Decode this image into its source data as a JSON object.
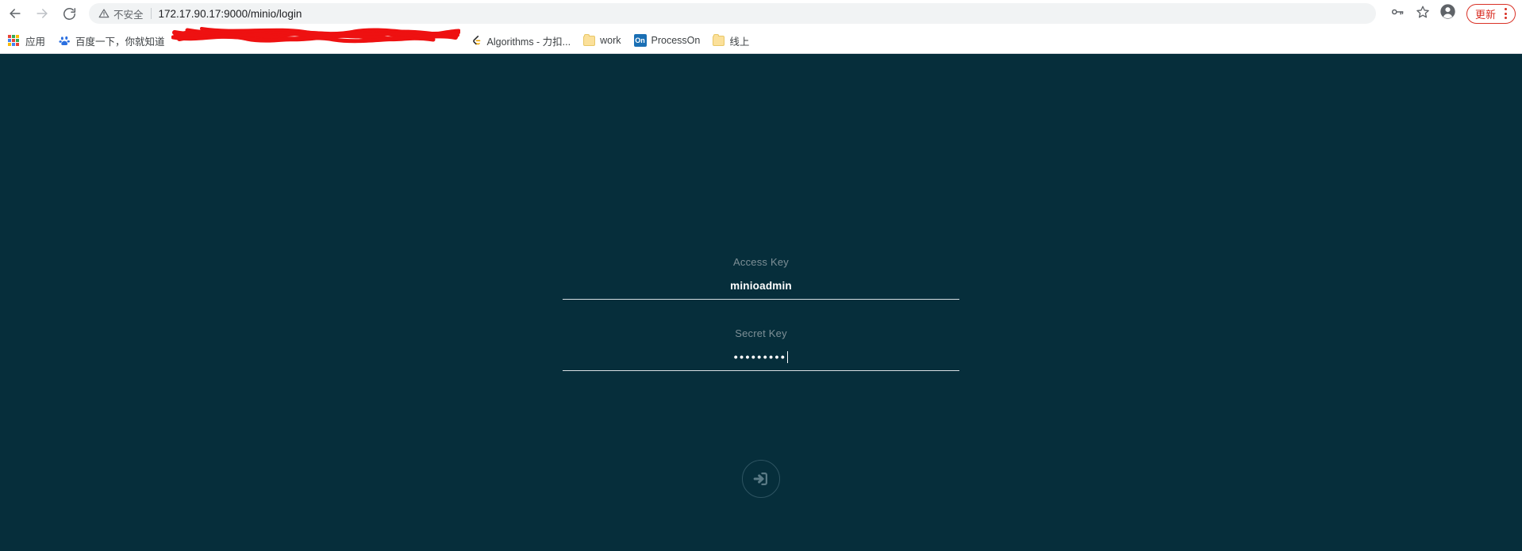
{
  "browser": {
    "nav": {
      "back_icon": "arrow-left-icon",
      "forward_icon": "arrow-right-icon",
      "reload_icon": "reload-icon"
    },
    "omnibox": {
      "security_icon": "warning-triangle-icon",
      "security_label": "不安全",
      "url": "172.17.90.17:9000/minio/login"
    },
    "toolbar_right": {
      "password_icon": "key-icon",
      "bookmark_icon": "star-icon",
      "profile_icon": "avatar-icon",
      "update_label": "更新",
      "menu_icon": "three-dots-vertical-icon"
    },
    "bookmarks": [
      {
        "label": "应用",
        "icon": "apps-grid-icon"
      },
      {
        "label": "百度一下，你就知道",
        "icon": "baidu-paw-icon"
      },
      {
        "label": "",
        "icon": "redacted-scribble",
        "redacted": true
      },
      {
        "label": "Algorithms - 力扣...",
        "icon": "leetcode-icon"
      },
      {
        "label": "work",
        "icon": "folder-icon"
      },
      {
        "label": "ProcessOn",
        "icon": "processon-icon",
        "icon_text": "On"
      },
      {
        "label": "线上",
        "icon": "folder-icon"
      }
    ]
  },
  "page": {
    "background_color": "#062e3b",
    "form": {
      "access_key": {
        "label": "Access Key",
        "value": "minioadmin"
      },
      "secret_key": {
        "label": "Secret Key",
        "value": "•••••••••",
        "masked": true
      },
      "submit": {
        "icon": "sign-in-icon",
        "label": ""
      }
    }
  }
}
